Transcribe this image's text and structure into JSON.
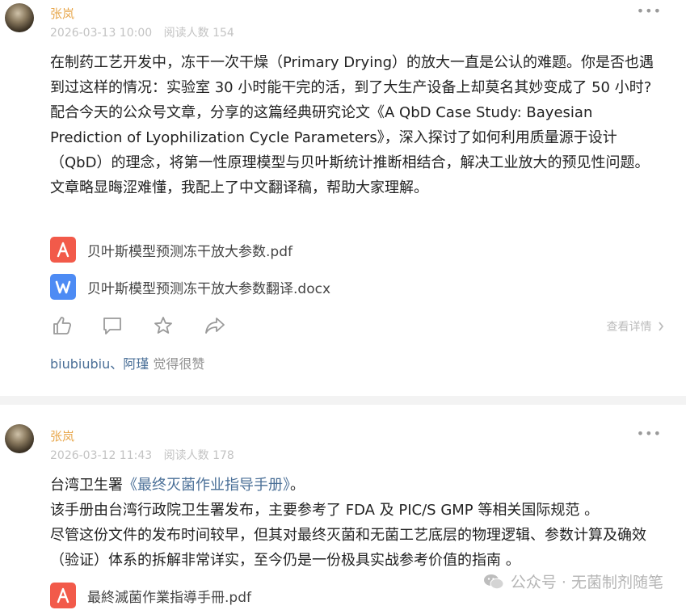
{
  "posts": [
    {
      "author": "张岚",
      "date": "2026-03-13 10:00",
      "reads": "阅读人数 154",
      "more": "•••",
      "paragraphs": [
        "在制药工艺开发中，冻干一次干燥（Primary Drying）的放大一直是公认的难题。你是否也遇到过这样的情况：实验室 30 小时能干完的活，到了大生产设备上却莫名其妙变成了 50 小时?",
        "配合今天的公众号文章，分享的这篇经典研究论文《A QbD Case Study: Bayesian Prediction of Lyophilization Cycle Parameters》，深入探讨了如何利用质量源于设计（QbD）的理念，将第一性原理模型与贝叶斯统计推断相结合，解决工业放大的预见性问题。 文章略显晦涩难懂，我配上了中文翻译稿，帮助大家理解。"
      ],
      "files": [
        {
          "name": "贝叶斯模型预测冻干放大参数.pdf",
          "type": "pdf-icon"
        },
        {
          "name": "贝叶斯模型预测冻干放大参数翻译.docx",
          "type": "word-icon"
        }
      ],
      "detail_link": "查看详情",
      "likes_names": "biubiubiu、阿瑾",
      "likes_suffix": " 觉得很赞"
    },
    {
      "author": "张岚",
      "date": "2026-03-12 11:43",
      "reads": "阅读人数 178",
      "more": "•••",
      "line1_prefix": "台湾卫生署",
      "line1_link": "《最终灭菌作业指导手册》",
      "line1_suffix": "。",
      "paragraphs": [
        "该手册由台湾行政院卫生署发布，主要参考了 FDA 及 PIC/S GMP 等相关国际规范 。",
        "尽管这份文件的发布时间较早，但其对最终灭菌和无菌工艺底层的物理逻辑、参数计算及确效（验证）体系的拆解非常详实，至今仍是一份极具实战参考价值的指南 。"
      ],
      "files": [
        {
          "name": "最終滅菌作業指導手冊.pdf",
          "type": "pdf-icon"
        }
      ]
    }
  ],
  "watermark": "公众号 · 无菌制剂随笔",
  "colors": {
    "author": "#e8a84f",
    "link": "#4a6f97",
    "pdf": "#f25a4a",
    "word": "#4d8bf4"
  }
}
